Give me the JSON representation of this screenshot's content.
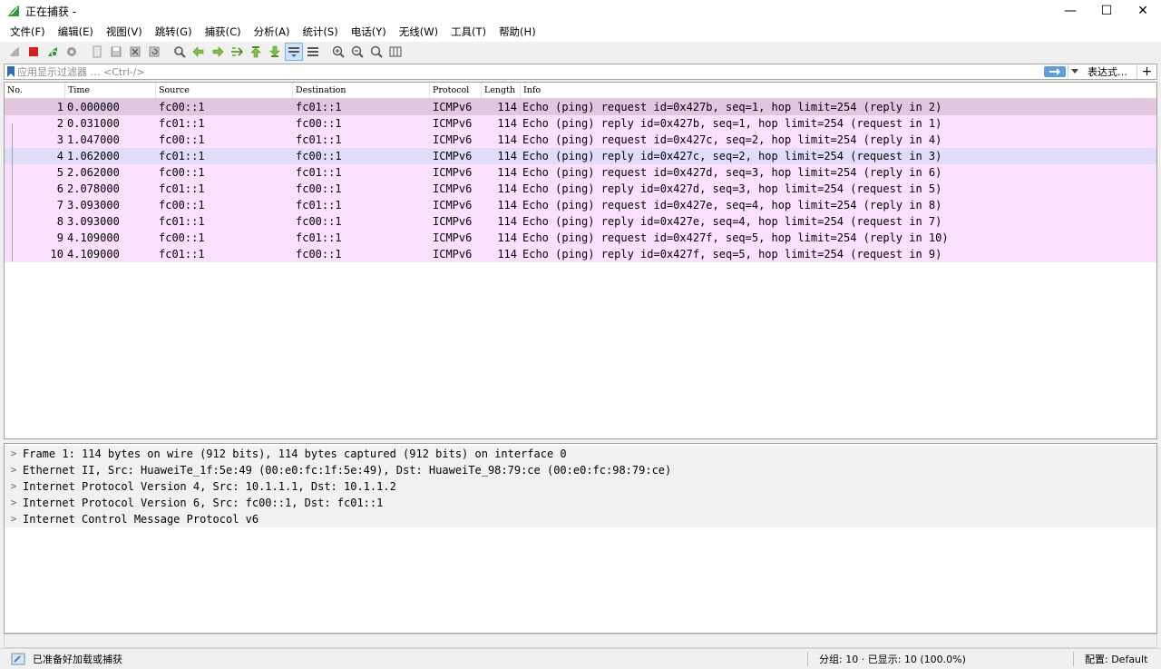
{
  "window": {
    "title": "正在捕获 -",
    "minimize": "—",
    "maximize": "☐",
    "close": "✕"
  },
  "menu": [
    "文件(F)",
    "编辑(E)",
    "视图(V)",
    "跳转(G)",
    "捕获(C)",
    "分析(A)",
    "统计(S)",
    "电话(Y)",
    "无线(W)",
    "工具(T)",
    "帮助(H)"
  ],
  "filter": {
    "placeholder": "应用显示过滤器 … <Ctrl-/>",
    "expression_label": "表达式…",
    "plus_label": "+"
  },
  "columns": [
    "No.",
    "Time",
    "Source",
    "Destination",
    "Protocol",
    "Length",
    "Info"
  ],
  "packets": [
    {
      "no": "1",
      "time": "0.000000",
      "src": "fc00::1",
      "dst": "fc01::1",
      "proto": "ICMPv6",
      "len": "114",
      "info": "Echo (ping) request id=0x427b, seq=1, hop limit=254 (reply in 2)"
    },
    {
      "no": "2",
      "time": "0.031000",
      "src": "fc01::1",
      "dst": "fc00::1",
      "proto": "ICMPv6",
      "len": "114",
      "info": "Echo (ping) reply id=0x427b, seq=1, hop limit=254 (request in 1)"
    },
    {
      "no": "3",
      "time": "1.047000",
      "src": "fc00::1",
      "dst": "fc01::1",
      "proto": "ICMPv6",
      "len": "114",
      "info": "Echo (ping) request id=0x427c, seq=2, hop limit=254 (reply in 4)"
    },
    {
      "no": "4",
      "time": "1.062000",
      "src": "fc01::1",
      "dst": "fc00::1",
      "proto": "ICMPv6",
      "len": "114",
      "info": "Echo (ping) reply id=0x427c, seq=2, hop limit=254 (request in 3)"
    },
    {
      "no": "5",
      "time": "2.062000",
      "src": "fc00::1",
      "dst": "fc01::1",
      "proto": "ICMPv6",
      "len": "114",
      "info": "Echo (ping) request id=0x427d, seq=3, hop limit=254 (reply in 6)"
    },
    {
      "no": "6",
      "time": "2.078000",
      "src": "fc01::1",
      "dst": "fc00::1",
      "proto": "ICMPv6",
      "len": "114",
      "info": "Echo (ping) reply id=0x427d, seq=3, hop limit=254 (request in 5)"
    },
    {
      "no": "7",
      "time": "3.093000",
      "src": "fc00::1",
      "dst": "fc01::1",
      "proto": "ICMPv6",
      "len": "114",
      "info": "Echo (ping) request id=0x427e, seq=4, hop limit=254 (reply in 8)"
    },
    {
      "no": "8",
      "time": "3.093000",
      "src": "fc01::1",
      "dst": "fc00::1",
      "proto": "ICMPv6",
      "len": "114",
      "info": "Echo (ping) reply id=0x427e, seq=4, hop limit=254 (request in 7)"
    },
    {
      "no": "9",
      "time": "4.109000",
      "src": "fc00::1",
      "dst": "fc01::1",
      "proto": "ICMPv6",
      "len": "114",
      "info": "Echo (ping) request id=0x427f, seq=5, hop limit=254 (reply in 10)"
    },
    {
      "no": "10",
      "time": "4.109000",
      "src": "fc01::1",
      "dst": "fc00::1",
      "proto": "ICMPv6",
      "len": "114",
      "info": "Echo (ping) reply id=0x427f, seq=5, hop limit=254 (request in 9)"
    }
  ],
  "details": [
    "Frame 1: 114 bytes on wire (912 bits), 114 bytes captured (912 bits) on interface 0",
    "Ethernet II, Src: HuaweiTe_1f:5e:49 (00:e0:fc:1f:5e:49), Dst: HuaweiTe_98:79:ce (00:e0:fc:98:79:ce)",
    "Internet Protocol Version 4, Src: 10.1.1.1, Dst: 10.1.1.2",
    "Internet Protocol Version 6, Src: fc00::1, Dst: fc01::1",
    "Internet Control Message Protocol v6"
  ],
  "status": {
    "ready": "已准备好加载或捕获",
    "packets": "分组: 10 · 已显示: 10 (100.0%)",
    "profile": "配置: Default"
  },
  "colors": {
    "icmp_row": "#fce0ff",
    "selected_row": "#e0c6df",
    "hover_row": "#e2dcfb",
    "accent": "#5c9fe0"
  }
}
